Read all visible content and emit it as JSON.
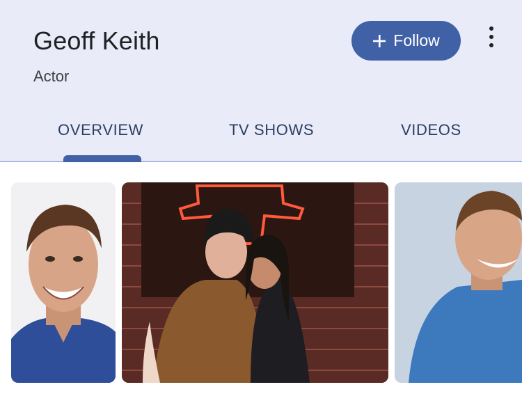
{
  "profile": {
    "name": "Geoff Keith",
    "role": "Actor"
  },
  "actions": {
    "follow_label": "Follow",
    "follow_icon": "plus-icon",
    "more_icon": "more-vert-icon"
  },
  "tabs": [
    {
      "label": "OVERVIEW",
      "selected": true
    },
    {
      "label": "TV SHOWS",
      "selected": false
    },
    {
      "label": "VIDEOS",
      "selected": false
    }
  ],
  "colors": {
    "header_background": "#e9ecf8",
    "accent": "#4161a6",
    "tab_text": "#2c3e63"
  },
  "images": [
    {
      "subject": "headshot smiling man navy shirt"
    },
    {
      "subject": "couple posing in front of brick wall with neon sign"
    },
    {
      "subject": "smiling man denim shirt"
    }
  ]
}
